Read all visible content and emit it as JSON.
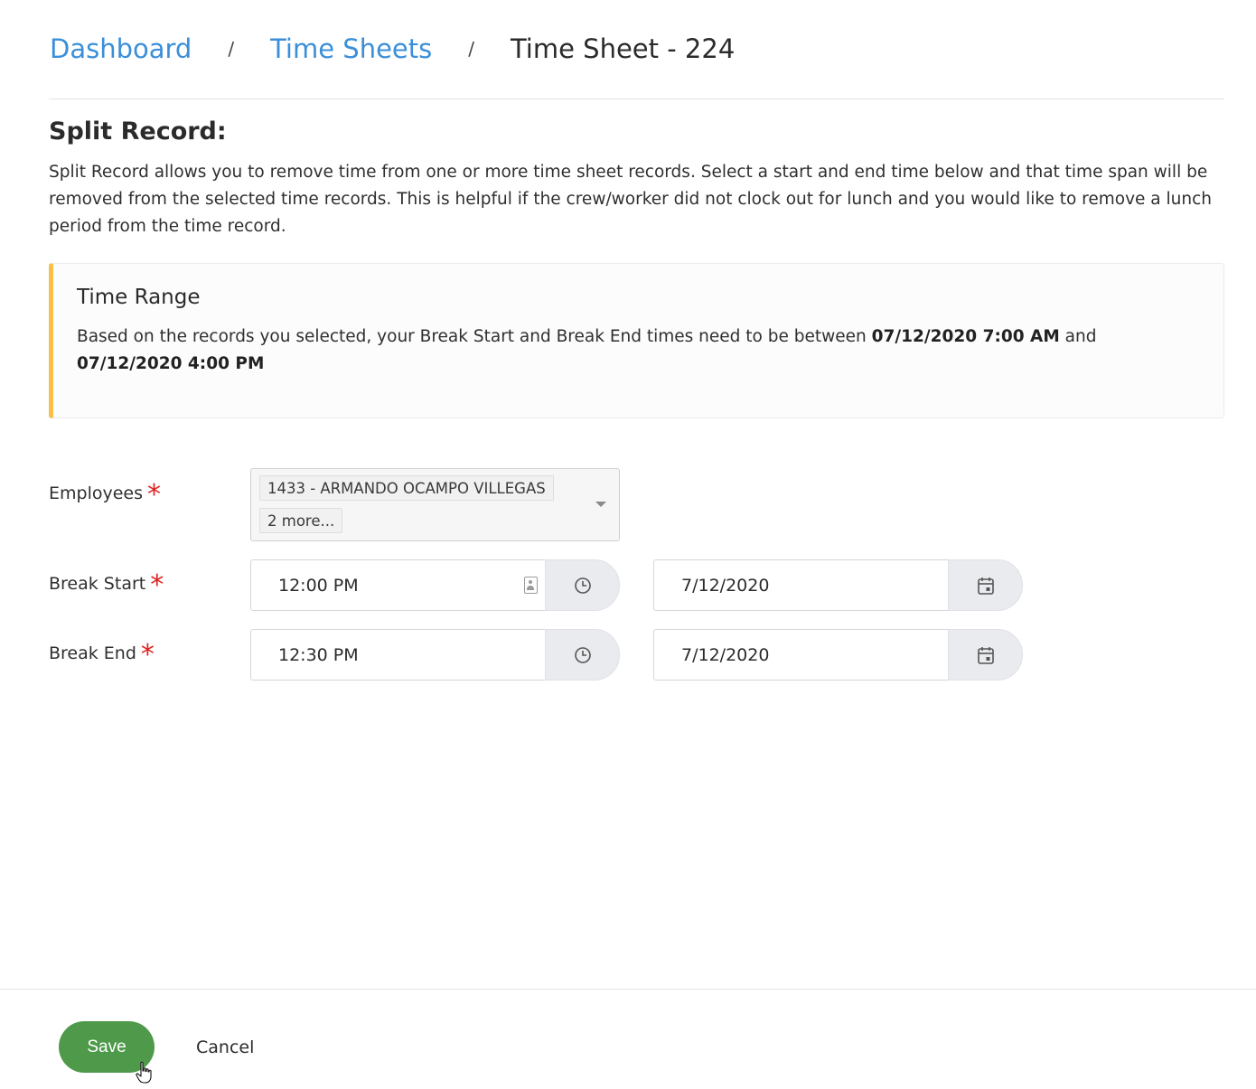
{
  "breadcrumb": {
    "items": [
      {
        "label": "Dashboard"
      },
      {
        "label": "Time Sheets"
      },
      {
        "label": "Time Sheet - 224"
      }
    ],
    "separator": "/"
  },
  "section": {
    "title": "Split Record:",
    "description": "Split Record allows you to remove time from one or more time sheet records. Select a start and end time below and that time span will be removed from the selected time records. This is helpful if the crew/worker did not clock out for lunch and you would like to remove a lunch period from the time record."
  },
  "callout": {
    "title": "Time Range",
    "text_before": "Based on the records you selected, your Break Start and Break End times need to be between ",
    "range_start": "07/12/2020 7:00 AM",
    "text_middle": " and ",
    "range_end": "07/12/2020 4:00 PM",
    "accent_color": "#f8c04a"
  },
  "form": {
    "required_marker": "*",
    "employees": {
      "label": "Employees",
      "selected": [
        "1433 - ARMANDO OCAMPO VILLEGAS"
      ],
      "more_label": "2 more..."
    },
    "break_start": {
      "label": "Break Start",
      "time": "12:00 PM",
      "date": "7/12/2020"
    },
    "break_end": {
      "label": "Break End",
      "time": "12:30 PM",
      "date": "7/12/2020"
    }
  },
  "footer": {
    "save_label": "Save",
    "cancel_label": "Cancel",
    "save_color": "#4e9a4a"
  },
  "icons": {
    "time_addon": "clock-icon",
    "date_addon": "calendar-icon",
    "autofill": "contact-card-icon",
    "dropdown": "caret-down-icon"
  }
}
